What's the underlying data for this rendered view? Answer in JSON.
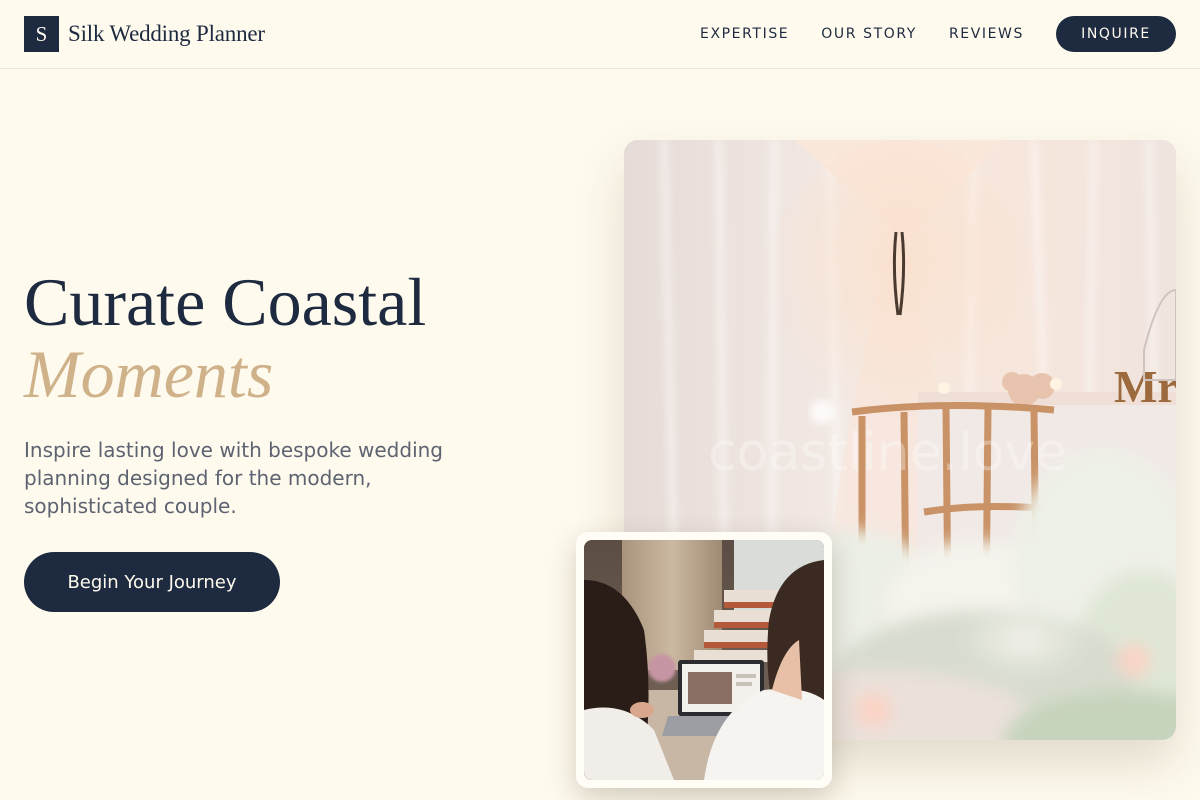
{
  "header": {
    "logo_letter": "S",
    "brand_name": "Silk Wedding Planner",
    "nav": [
      {
        "label": "EXPERTISE"
      },
      {
        "label": "OUR STORY"
      },
      {
        "label": "REVIEWS"
      }
    ],
    "cta_label": "INQUIRE"
  },
  "hero": {
    "title_line1": "Curate Coastal",
    "title_line2": "Moments",
    "subtitle": "Inspire lasting love with bespoke wedding planning designed for the modern, sophisticated couple.",
    "cta_label": "Begin Your Journey"
  },
  "images": {
    "main": {
      "watermark": "coastline.love",
      "sign_text": "Mr"
    }
  },
  "colors": {
    "background": "#fefaee",
    "navy": "#1e2a3f",
    "gold_accent": "#cfb28a",
    "muted_text": "#5d6370"
  }
}
